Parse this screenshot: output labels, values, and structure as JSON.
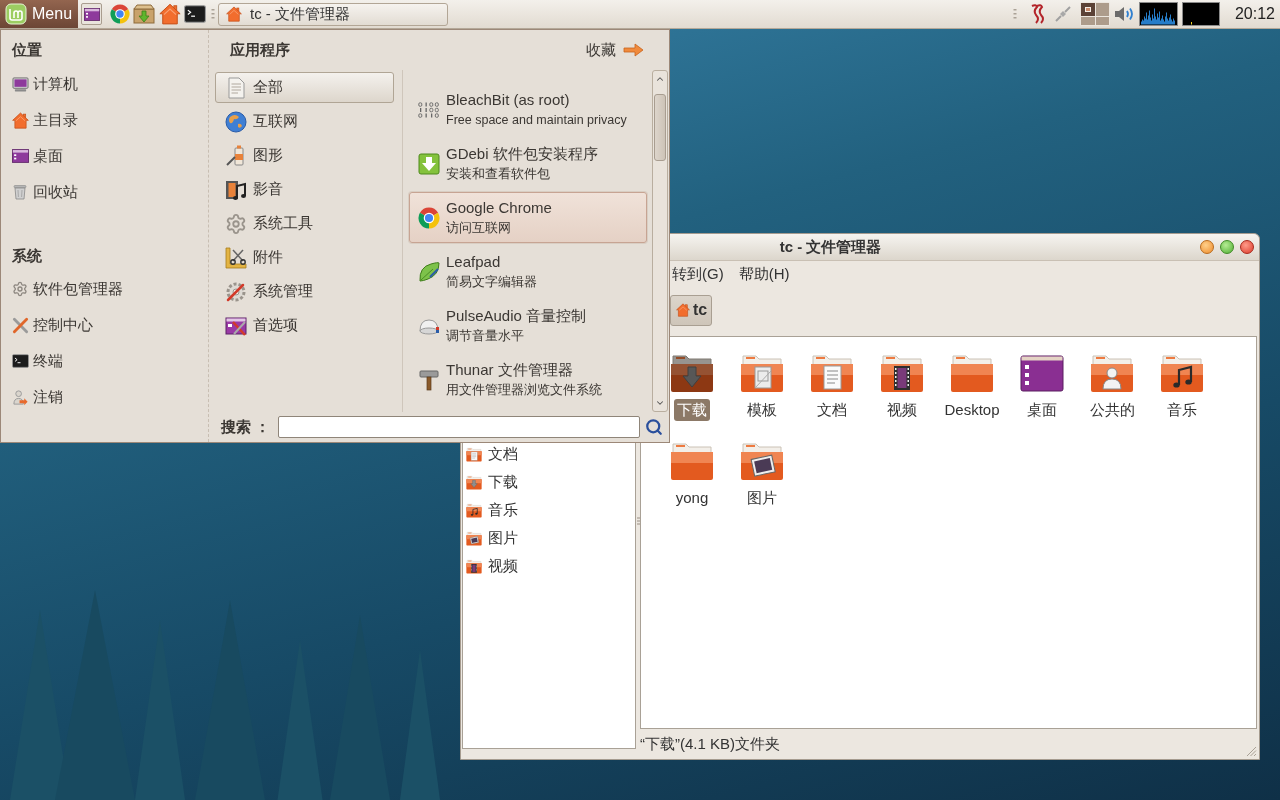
{
  "top_panel": {
    "menu_button": "Menu",
    "taskbar": [
      {
        "title": "tc - 文件管理器"
      }
    ],
    "workspaces": [
      {
        "selected": true
      },
      {
        "selected": false
      },
      {
        "selected": false
      },
      {
        "selected": false
      }
    ],
    "clock": "20:12"
  },
  "menu": {
    "places": {
      "heading": "位置",
      "items": [
        "计算机",
        "主目录",
        "桌面",
        "回收站"
      ]
    },
    "system": {
      "heading": "系统",
      "items": [
        "软件包管理器",
        "控制中心",
        "终端",
        "注销"
      ]
    },
    "applications": {
      "heading": "应用程序",
      "categories": [
        {
          "label": "全部",
          "selected": true
        },
        {
          "label": "互联网",
          "selected": false
        },
        {
          "label": "图形",
          "selected": false
        },
        {
          "label": "影音",
          "selected": false
        },
        {
          "label": "系统工具",
          "selected": false
        },
        {
          "label": "附件",
          "selected": false
        },
        {
          "label": "系统管理",
          "selected": false
        },
        {
          "label": "首选项",
          "selected": false
        }
      ]
    },
    "favorites_button": "收藏",
    "apps": [
      {
        "name": "BleachBit (as root)",
        "description": "Free space and maintain privacy",
        "selected": false
      },
      {
        "name": "GDebi 软件包安装程序",
        "description": "安装和查看软件包",
        "selected": false
      },
      {
        "name": "Google Chrome",
        "description": "访问互联网",
        "selected": true
      },
      {
        "name": "Leafpad",
        "description": "简易文字编辑器",
        "selected": false
      },
      {
        "name": "PulseAudio 音量控制",
        "description": "调节音量水平",
        "selected": false
      },
      {
        "name": "Thunar 文件管理器",
        "description": "用文件管理器浏览文件系统",
        "selected": false
      }
    ],
    "search": {
      "label": "搜索 ："
    }
  },
  "file_manager": {
    "title": "tc - 文件管理器",
    "menubar": [
      "转到(G)",
      "帮助(H)"
    ],
    "path_button": "tc",
    "sidebar": [
      {
        "label": "文档",
        "kind": "documents"
      },
      {
        "label": "下载",
        "kind": "download"
      },
      {
        "label": "音乐",
        "kind": "music"
      },
      {
        "label": "图片",
        "kind": "pictures"
      },
      {
        "label": "视频",
        "kind": "videos"
      }
    ],
    "files": [
      {
        "name": "下载",
        "kind": "download",
        "selected": true
      },
      {
        "name": "模板",
        "kind": "templates",
        "selected": false
      },
      {
        "name": "文档",
        "kind": "documents",
        "selected": false
      },
      {
        "name": "视频",
        "kind": "videos",
        "selected": false
      },
      {
        "name": "Desktop",
        "kind": "folder",
        "selected": false
      },
      {
        "name": "桌面",
        "kind": "desktop",
        "selected": false
      },
      {
        "name": "公共的",
        "kind": "public",
        "selected": false
      },
      {
        "name": "音乐",
        "kind": "music",
        "selected": false
      },
      {
        "name": "yong",
        "kind": "folder",
        "selected": false
      },
      {
        "name": "图片",
        "kind": "pictures",
        "selected": false
      }
    ],
    "status_bar": "“下载”(4.1 KB)文件夹"
  }
}
